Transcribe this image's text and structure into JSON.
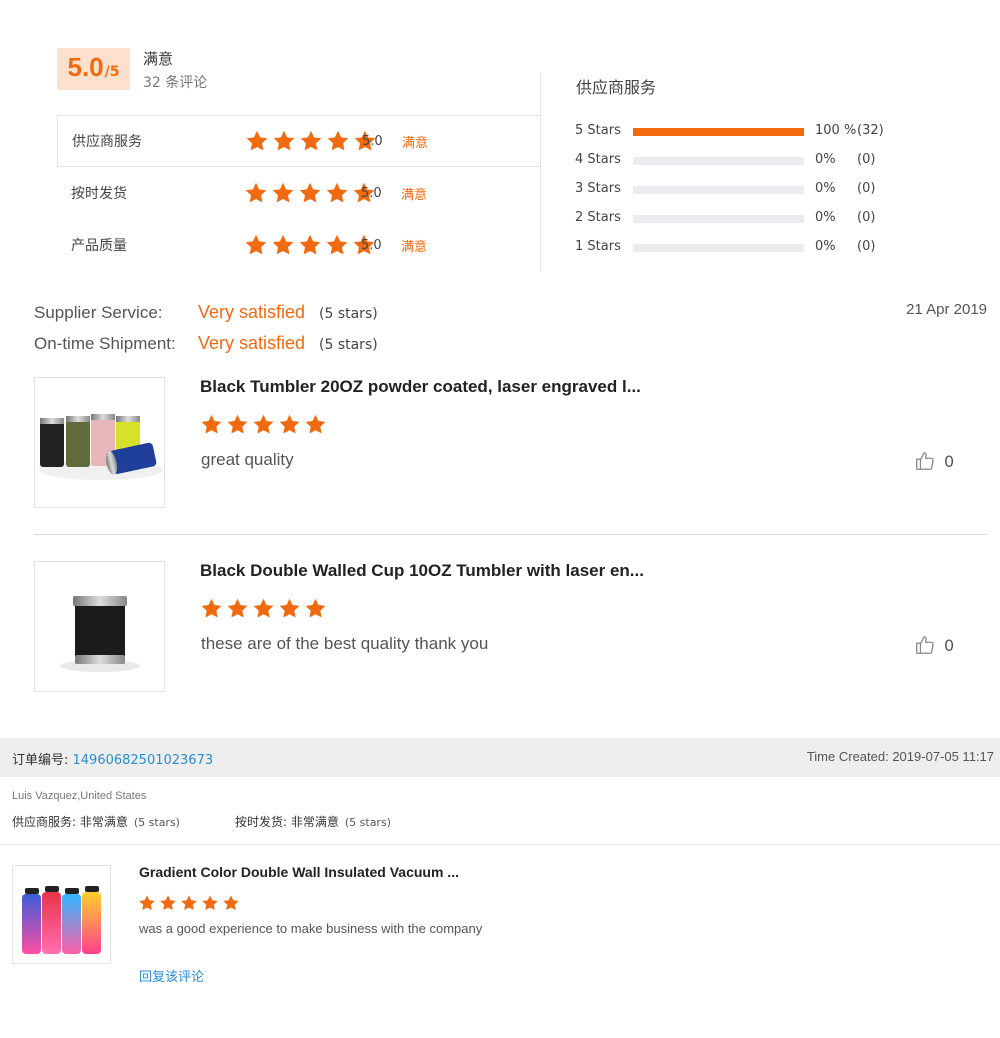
{
  "summary": {
    "score": "5.0",
    "score_suffix": "/5",
    "word": "满意",
    "count": "32 条评论"
  },
  "dimensions": [
    {
      "label": "供应商服务",
      "score": "5.0",
      "word": "满意",
      "stars": 5
    },
    {
      "label": "按时发货",
      "score": "5.0",
      "word": "满意",
      "stars": 5
    },
    {
      "label": "产品质量",
      "score": "5.0",
      "word": "满意",
      "stars": 5
    }
  ],
  "distribution": {
    "title": "供应商服务",
    "rows": [
      {
        "label": "5  Stars",
        "pct": "100 %",
        "count": "(32)",
        "fraction": 1.0
      },
      {
        "label": "4  Stars",
        "pct": "0%",
        "count": "(0)",
        "fraction": 0
      },
      {
        "label": "3  Stars",
        "pct": "0%",
        "count": "(0)",
        "fraction": 0
      },
      {
        "label": "2  Stars",
        "pct": "0%",
        "count": "(0)",
        "fraction": 0
      },
      {
        "label": "1  Stars",
        "pct": "0%",
        "count": "(0)",
        "fraction": 0
      }
    ]
  },
  "review1": {
    "supplier_label": "Supplier Service:",
    "supplier_value": "Very satisfied",
    "supplier_stars": "(5 stars)",
    "shipment_label": "On-time Shipment:",
    "shipment_value": "Very satisfied",
    "shipment_stars": "(5 stars)",
    "date": "21 Apr 2019",
    "items": [
      {
        "title": "Black Tumbler 20OZ powder coated, laser engraved l...",
        "text": "great quality",
        "likes": "0",
        "stars": 5
      },
      {
        "title": "Black Double Walled Cup 10OZ Tumbler with laser en...",
        "text": "these are of the best quality thank you",
        "likes": "0",
        "stars": 5
      }
    ]
  },
  "order": {
    "label": "订单编号: ",
    "number": "14960682501023673",
    "time": "Time Created: 2019-07-05 11:17",
    "buyer": "Luis Vazquez,United States",
    "supplier_label": "供应商服务: 非常满意",
    "supplier_stars": "(5 stars)",
    "shipment_label": "按时发货: 非常满意",
    "shipment_stars": "(5 stars)",
    "item_title": "Gradient Color Double Wall Insulated Vacuum ...",
    "item_text": "was a good experience to make business with the company",
    "reply": "回复该评论",
    "stars": 5
  },
  "colors": {
    "accent": "#f26a10",
    "link": "#2a8dd4"
  }
}
